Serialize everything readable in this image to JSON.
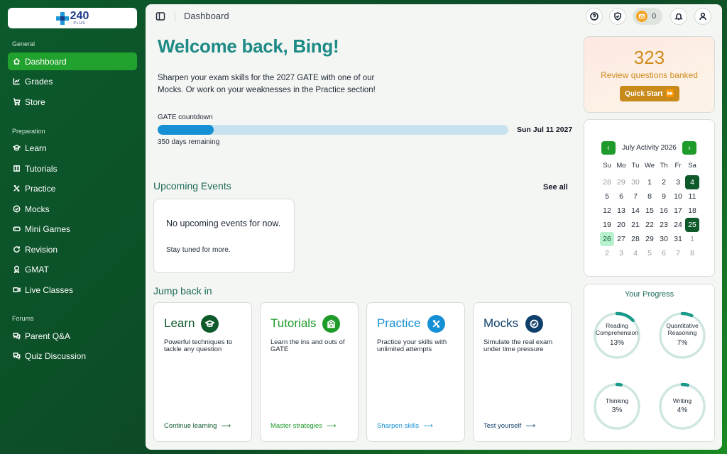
{
  "brand": {
    "name": "240",
    "sub": "PLUS"
  },
  "sidebar": {
    "sections": [
      {
        "title": "General",
        "items": [
          {
            "label": "Dashboard",
            "icon": "home-icon",
            "active": true
          },
          {
            "label": "Grades",
            "icon": "chart-icon"
          },
          {
            "label": "Store",
            "icon": "cart-icon"
          }
        ]
      },
      {
        "title": "Preparation",
        "items": [
          {
            "label": "Learn",
            "icon": "mortarboard-icon"
          },
          {
            "label": "Tutorials",
            "icon": "book-icon"
          },
          {
            "label": "Practice",
            "icon": "tools-icon"
          },
          {
            "label": "Mocks",
            "icon": "check-circle-icon"
          },
          {
            "label": "Mini Games",
            "icon": "gamepad-icon"
          },
          {
            "label": "Revision",
            "icon": "refresh-icon"
          },
          {
            "label": "GMAT",
            "icon": "award-icon"
          },
          {
            "label": "Live Classes",
            "icon": "video-icon"
          }
        ]
      },
      {
        "title": "Forums",
        "items": [
          {
            "label": "Parent Q&A",
            "icon": "chat-icon"
          },
          {
            "label": "Quiz Discussion",
            "icon": "chat-icon"
          }
        ]
      }
    ]
  },
  "topbar": {
    "breadcrumb": "Dashboard",
    "coins": "0"
  },
  "main": {
    "welcome": "Welcome back, Bing!",
    "intro": "Sharpen your exam skills for the 2027 GATE with one of our Mocks. Or work on your weaknesses in the Practice section!",
    "countdown": {
      "label": "GATE countdown",
      "date": "Sun Jul 11 2027",
      "remaining": "350 days remaining",
      "progress": 0.16
    },
    "events": {
      "title": "Upcoming Events",
      "see_all": "See all",
      "empty": "No upcoming events for now.",
      "sub": "Stay tuned for more."
    },
    "jump": {
      "title": "Jump back in",
      "cards": [
        {
          "title": "Learn",
          "desc": "Powerful techniques to tackle any question",
          "link": "Continue learning",
          "color": "#0f5a2a",
          "link_color": "#0f5a2a",
          "icon": "mortarboard-icon"
        },
        {
          "title": "Tutorials",
          "desc": "Learn the ins and outs of GATE",
          "link": "Master strategies",
          "color": "#1e9b2a",
          "link_color": "#1e9b2a",
          "icon": "building-icon"
        },
        {
          "title": "Practice",
          "desc": "Practice your skills with unlimited attempts",
          "link": "Sharpen skills",
          "color": "#1690d4",
          "link_color": "#1690d4",
          "icon": "tools-icon"
        },
        {
          "title": "Mocks",
          "desc": "Simulate the real exam under time pressure",
          "link": "Test yourself",
          "color": "#0f3f6b",
          "link_color": "#0f3f6b",
          "icon": "check-circle-icon"
        }
      ]
    }
  },
  "review": {
    "count": "323",
    "label": "Review questions banked",
    "button": "Quick Start"
  },
  "calendar": {
    "title": "July Activity 2026",
    "weekdays": [
      "Su",
      "Mo",
      "Tu",
      "We",
      "Th",
      "Fr",
      "Sa"
    ],
    "days": [
      {
        "d": "28",
        "m": true
      },
      {
        "d": "29",
        "m": true
      },
      {
        "d": "30",
        "m": true
      },
      {
        "d": "1"
      },
      {
        "d": "2"
      },
      {
        "d": "3"
      },
      {
        "d": "4",
        "s": "done"
      },
      {
        "d": "5"
      },
      {
        "d": "6"
      },
      {
        "d": "7"
      },
      {
        "d": "8"
      },
      {
        "d": "9"
      },
      {
        "d": "10"
      },
      {
        "d": "11"
      },
      {
        "d": "12"
      },
      {
        "d": "13"
      },
      {
        "d": "14"
      },
      {
        "d": "15"
      },
      {
        "d": "16"
      },
      {
        "d": "17"
      },
      {
        "d": "18"
      },
      {
        "d": "19"
      },
      {
        "d": "20"
      },
      {
        "d": "21"
      },
      {
        "d": "22"
      },
      {
        "d": "23"
      },
      {
        "d": "24"
      },
      {
        "d": "25",
        "s": "done"
      },
      {
        "d": "26",
        "s": "today"
      },
      {
        "d": "27"
      },
      {
        "d": "28"
      },
      {
        "d": "29"
      },
      {
        "d": "30"
      },
      {
        "d": "31"
      },
      {
        "d": "1",
        "m": true
      },
      {
        "d": "2",
        "m": true
      },
      {
        "d": "3",
        "m": true
      },
      {
        "d": "4",
        "m": true
      },
      {
        "d": "5",
        "m": true
      },
      {
        "d": "6",
        "m": true
      },
      {
        "d": "7",
        "m": true
      },
      {
        "d": "8",
        "m": true
      }
    ]
  },
  "progress": {
    "title": "Your Progress",
    "items": [
      {
        "label": "Reading Comprehension",
        "pct": "13%",
        "value": 0.13
      },
      {
        "label": "Quantitative Reasoning",
        "pct": "7%",
        "value": 0.07
      },
      {
        "label": "Thinking",
        "pct": "3%",
        "value": 0.03
      },
      {
        "label": "Writing",
        "pct": "4%",
        "value": 0.04
      }
    ]
  },
  "colors": {
    "accent": "#21a12d",
    "teal": "#1d8a86",
    "ring_track": "#cfe6e1",
    "ring_fill": "#1a9a8a",
    "gold": "#c88a1a"
  }
}
